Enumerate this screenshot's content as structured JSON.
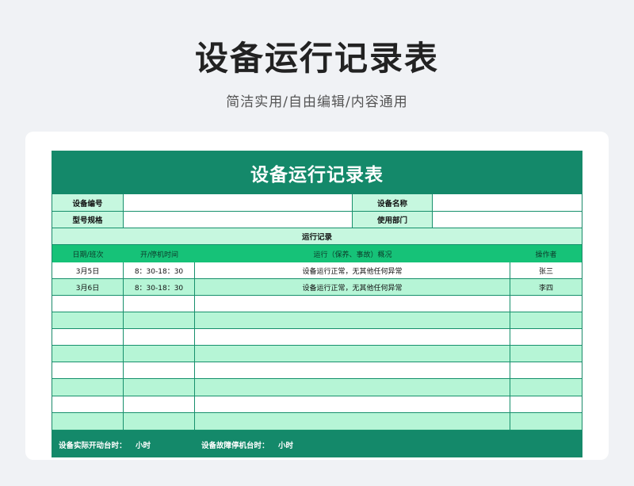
{
  "header": {
    "title": "设备运行记录表",
    "subtitle": "简洁实用/自由编辑/内容通用"
  },
  "sheet": {
    "title": "设备运行记录表",
    "info": {
      "device_no_label": "设备编号",
      "device_name_label": "设备名称",
      "model_label": "型号规格",
      "department_label": "使用部门"
    },
    "section_title": "运行记录",
    "columns": [
      "日期/班次",
      "开/停机时间",
      "运行（保养、事故）概况",
      "操作者"
    ],
    "rows": [
      [
        "3月5日",
        "8：30-18：30",
        "设备运行正常，无其他任何异常",
        "张三"
      ],
      [
        "3月6日",
        "8：30-18：30",
        "设备运行正常，无其他任何异常",
        "李四"
      ],
      [
        "",
        "",
        "",
        ""
      ],
      [
        "",
        "",
        "",
        ""
      ],
      [
        "",
        "",
        "",
        ""
      ],
      [
        "",
        "",
        "",
        ""
      ],
      [
        "",
        "",
        "",
        ""
      ],
      [
        "",
        "",
        "",
        ""
      ],
      [
        "",
        "",
        "",
        ""
      ],
      [
        "",
        "",
        "",
        ""
      ]
    ],
    "footer": {
      "actual_label": "设备实际开动台时：",
      "actual_unit": "小时",
      "fault_label": "设备故障停机台时：",
      "fault_unit": "小时"
    }
  },
  "colors": {
    "dark_green": "#14896a",
    "header_green": "#16c278",
    "light_green": "#c6f7df",
    "background": "#f0f2f5"
  }
}
